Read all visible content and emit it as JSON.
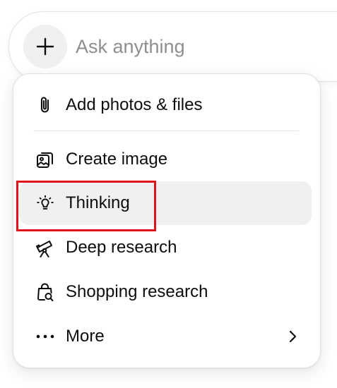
{
  "composer": {
    "placeholder": "Ask anything",
    "plus_icon": "plus-icon"
  },
  "menu": {
    "items": [
      {
        "label": "Add photos & files",
        "icon": "paperclip-icon"
      },
      {
        "label": "Create image",
        "icon": "image-icon"
      },
      {
        "label": "Thinking",
        "icon": "lightbulb-icon",
        "active": true,
        "highlighted": true
      },
      {
        "label": "Deep research",
        "icon": "telescope-icon"
      },
      {
        "label": "Shopping research",
        "icon": "shopping-bag-icon"
      },
      {
        "label": "More",
        "icon": "more-dots-icon",
        "has_submenu": true,
        "submenu_icon": "chevron-right-icon"
      }
    ]
  },
  "colors": {
    "highlight_border": "#e0131a",
    "active_item_bg": "#f0f0f0",
    "placeholder_text": "#8f8f8f"
  }
}
